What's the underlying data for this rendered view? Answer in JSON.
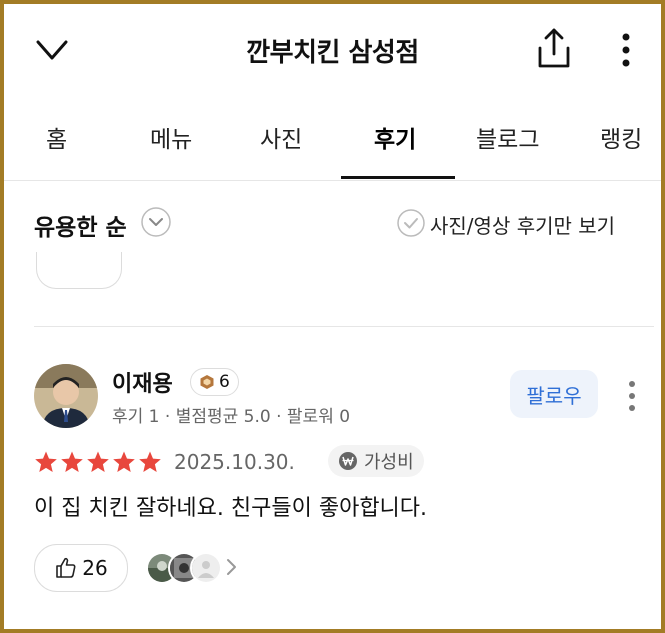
{
  "header": {
    "title": "깐부치킨 삼성점"
  },
  "tabs": [
    {
      "label": "홈"
    },
    {
      "label": "메뉴"
    },
    {
      "label": "사진"
    },
    {
      "label": "후기",
      "active": true
    },
    {
      "label": "블로그"
    },
    {
      "label": "랭킹"
    }
  ],
  "sort_bar": {
    "sort_label": "유용한 순",
    "media_only_label": "사진/영상 후기만 보기"
  },
  "review": {
    "reviewer_name": "이재용",
    "level": "6",
    "meta": "후기 1 · 별점평균 5.0 · 팔로워 0",
    "follow_label": "팔로우",
    "rating": 5,
    "date": "2025.10.30.",
    "tag": "가성비",
    "text": "이 집 치킨 잘하네요. 친구들이 좋아합니다.",
    "like_count": "26"
  },
  "colors": {
    "frame": "#a37c25",
    "star": "#e8473d",
    "follow_text": "#2f6fd6",
    "follow_bg": "#eef3fb"
  },
  "icons": [
    "chevron-down-icon",
    "share-icon",
    "more-vertical-icon",
    "check-circle-icon",
    "won-icon",
    "thumbs-up-icon",
    "chevron-right-icon"
  ]
}
